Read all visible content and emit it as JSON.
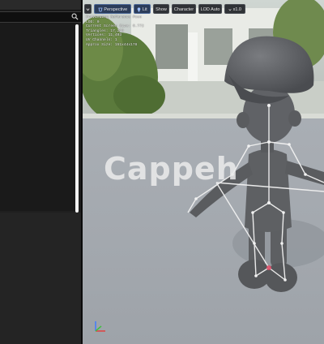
{
  "viewport": {
    "toolbar": {
      "perspective_label": "Perspective",
      "lit_label": "Lit",
      "show_label": "Show",
      "character_label": "Character",
      "lod_label": "LOD Auto",
      "scale_label": "x1.0"
    },
    "stats_lines": [
      "Previewing Reference Pose",
      "LOD: 0",
      "Current Screen Size: 0.772",
      "Triangles: 17,260",
      "Vertices: 11,403",
      "UV Channels: 1",
      "Approx Size: 151x44x178"
    ],
    "watermark": "Cappeh"
  },
  "colors": {
    "panel_bg": "#1f1f1f",
    "viewport_floor": "#a8adb4",
    "character_gray": "#5c5e61",
    "bone_white": "#f2f2f2",
    "accent_blue": "#4d6a9a"
  }
}
